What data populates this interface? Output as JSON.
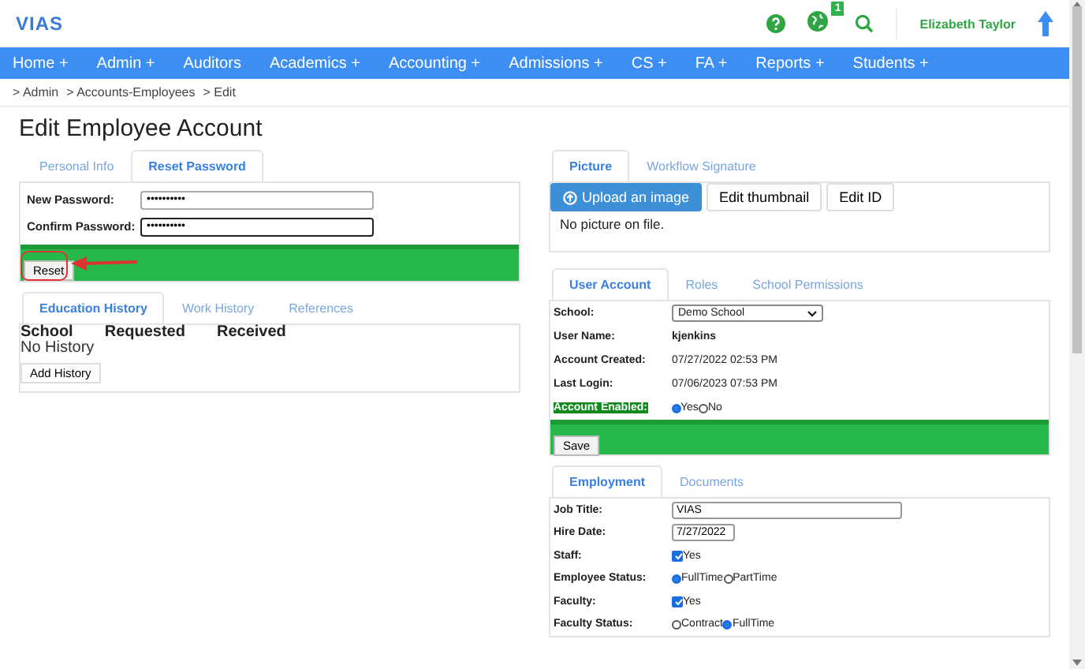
{
  "header": {
    "logo": "VIAS",
    "notification_count": "1",
    "user_name": "Elizabeth Taylor"
  },
  "nav": [
    {
      "label": "Home +"
    },
    {
      "label": "Admin +"
    },
    {
      "label": "Auditors"
    },
    {
      "label": "Academics +"
    },
    {
      "label": "Accounting +"
    },
    {
      "label": "Admissions +"
    },
    {
      "label": "CS +"
    },
    {
      "label": "FA +"
    },
    {
      "label": "Reports +"
    },
    {
      "label": "Students +"
    }
  ],
  "breadcrumb": [
    "> Admin",
    "> Accounts-Employees",
    "> Edit"
  ],
  "title": "Edit Employee Account",
  "password_panel": {
    "tabs": [
      {
        "label": "Personal Info",
        "selected": false
      },
      {
        "label": "Reset Password",
        "selected": true
      }
    ],
    "fields": [
      {
        "label": "New Password:",
        "value": "••••••••••",
        "focused": false
      },
      {
        "label": "Confirm Password:",
        "value": "••••••••••",
        "focused": true
      }
    ],
    "button": "Reset"
  },
  "history_panel": {
    "tabs": [
      {
        "label": "Education History",
        "selected": true
      },
      {
        "label": "Work History",
        "selected": false
      },
      {
        "label": "References",
        "selected": false
      }
    ],
    "columns": [
      "School",
      "Requested",
      "Received"
    ],
    "empty_text": "No History",
    "button": "Add History"
  },
  "picture_panel": {
    "tabs": [
      {
        "label": "Picture",
        "selected": true
      },
      {
        "label": "Workflow Signature",
        "selected": false
      }
    ],
    "buttons": [
      {
        "label": "Upload an image",
        "kind": "primary"
      },
      {
        "label": "Edit thumbnail",
        "kind": "default"
      },
      {
        "label": "Edit ID",
        "kind": "default"
      }
    ],
    "message": "No picture on file."
  },
  "account_panel": {
    "tabs": [
      {
        "label": "User Account",
        "selected": true
      },
      {
        "label": "Roles",
        "selected": false
      },
      {
        "label": "School Permissions",
        "selected": false
      }
    ],
    "rows": [
      {
        "label": "School:",
        "kind": "select",
        "value": "Demo School",
        "highlighted": false
      },
      {
        "label": "User Name:",
        "kind": "bold-text",
        "value": "kjenkins",
        "highlighted": false
      },
      {
        "label": "Account Created:",
        "kind": "text",
        "value": "07/27/2022 02:53 PM",
        "highlighted": false
      },
      {
        "label": "Last Login:",
        "kind": "text",
        "value": "07/06/2023 07:53 PM",
        "highlighted": false
      },
      {
        "label": "Account Enabled:",
        "kind": "radio",
        "options": [
          {
            "label": "Yes",
            "selected": true
          },
          {
            "label": "No",
            "selected": false
          }
        ],
        "highlighted": true
      }
    ],
    "button": "Save"
  },
  "employment_panel": {
    "tabs": [
      {
        "label": "Employment",
        "selected": true
      },
      {
        "label": "Documents",
        "selected": false
      }
    ],
    "rows": [
      {
        "label": "Job Title:",
        "kind": "input",
        "value": "VIAS",
        "wide": true
      },
      {
        "label": "Hire Date:",
        "kind": "input",
        "value": "7/27/2022",
        "wide": false
      },
      {
        "label": "Staff:",
        "kind": "checkbox",
        "option": {
          "label": "Yes",
          "checked": true
        }
      },
      {
        "label": "Employee Status:",
        "kind": "radio",
        "options": [
          {
            "label": "FullTime",
            "selected": true
          },
          {
            "label": "PartTime",
            "selected": false
          }
        ]
      },
      {
        "label": "Faculty:",
        "kind": "checkbox",
        "option": {
          "label": "Yes",
          "checked": true
        }
      },
      {
        "label": "Faculty Status:",
        "kind": "radio",
        "options": [
          {
            "label": "Contract",
            "selected": false
          },
          {
            "label": "FullTime",
            "selected": true
          }
        ]
      }
    ]
  }
}
